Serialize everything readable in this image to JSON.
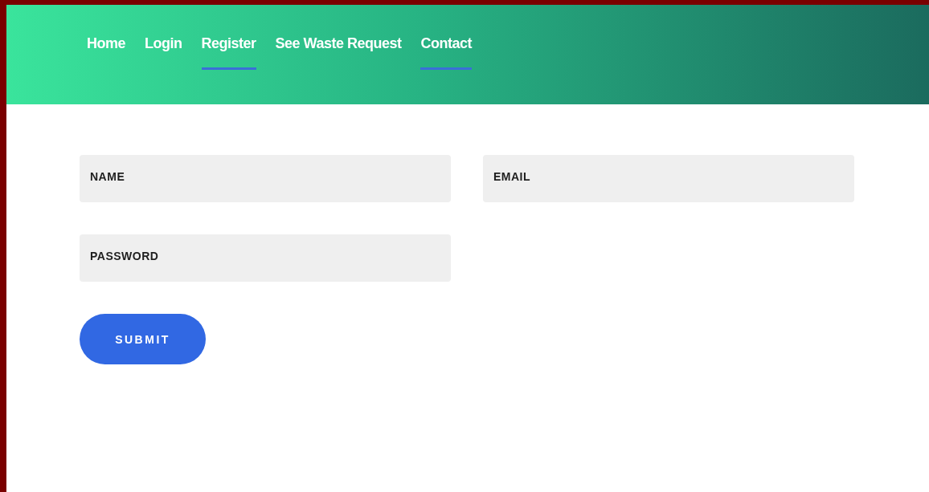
{
  "nav": [
    {
      "label": "Home",
      "selected": false
    },
    {
      "label": "Login",
      "selected": false
    },
    {
      "label": "Register",
      "selected": true
    },
    {
      "label": "See Waste Request",
      "selected": false
    },
    {
      "label": "Contact",
      "selected": true
    }
  ],
  "form": {
    "fields": [
      {
        "placeholder": "NAME"
      },
      {
        "placeholder": "EMAIL"
      },
      {
        "placeholder": "PASSWORD"
      }
    ],
    "submit": "SUBMIT"
  }
}
